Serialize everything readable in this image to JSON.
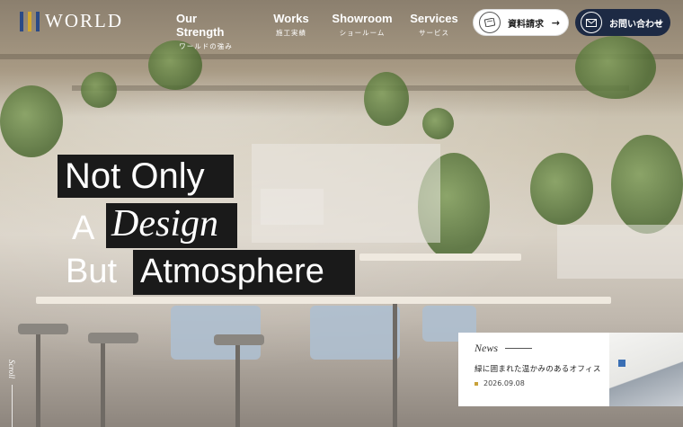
{
  "brand": {
    "name": "WORLD",
    "mark_colors": [
      "#2b4a86",
      "#d4a82f",
      "#2b4a86"
    ]
  },
  "nav": [
    {
      "en": "Our Strength",
      "ja": "ワールドの強み"
    },
    {
      "en": "Works",
      "ja": "施工実績"
    },
    {
      "en": "Showroom",
      "ja": "ショールーム"
    },
    {
      "en": "Services",
      "ja": "サービス"
    }
  ],
  "buttons": {
    "document": {
      "label": "資料請求",
      "icon": "document-icon",
      "arrow": "→"
    },
    "contact": {
      "label": "お問い合わせ",
      "icon": "mail-icon",
      "arrow": "→"
    }
  },
  "headline": {
    "line1": "Not Only",
    "line2_prefix": "A",
    "line2_emphasis": "Design",
    "line3_prefix": "But",
    "line3_emphasis": "Atmosphere"
  },
  "news": {
    "label": "News",
    "title": "緑に囲まれた温かみのあるオフィス",
    "date": "2026.09.08",
    "accent": "#c8a13a"
  },
  "scroll": {
    "label": "Scroll"
  },
  "colors": {
    "navy": "#1d2a44",
    "box": "#1a1a1a"
  }
}
